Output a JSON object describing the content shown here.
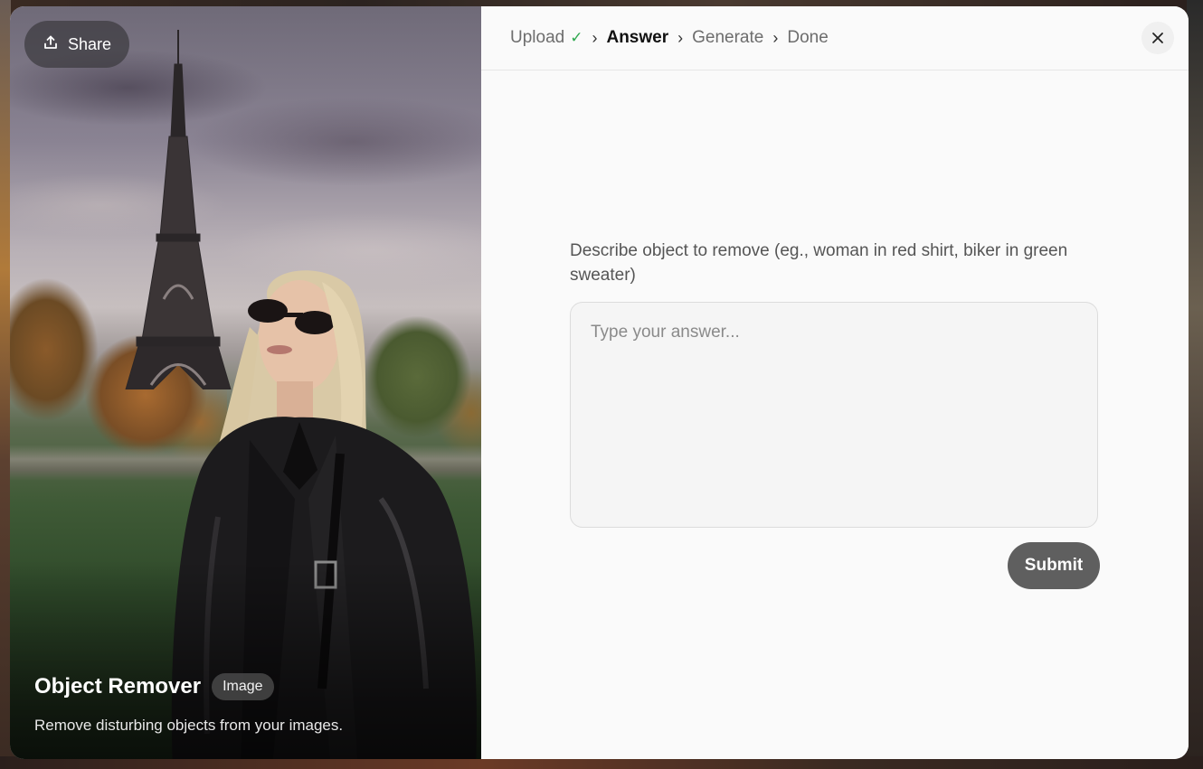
{
  "hero": {
    "share_label": "Share",
    "share_icon": "upload-share-icon",
    "title": "Object Remover",
    "badge": "Image",
    "subtitle": "Remove disturbing objects from your images."
  },
  "steps": {
    "items": [
      {
        "label": "Upload",
        "state": "completed"
      },
      {
        "label": "Answer",
        "state": "active"
      },
      {
        "label": "Generate",
        "state": "pending"
      },
      {
        "label": "Done",
        "state": "pending"
      }
    ],
    "check_mark": "✓",
    "separator": "›"
  },
  "form": {
    "question": "Describe object to remove (eg., woman in red shirt, biker in green sweater)",
    "answer_placeholder": "Type your answer...",
    "answer_value": "",
    "submit_label": "Submit"
  },
  "colors": {
    "check_green": "#2fa84f",
    "submit_bg": "#5f5f5f",
    "panel_bg": "#fafafa"
  }
}
